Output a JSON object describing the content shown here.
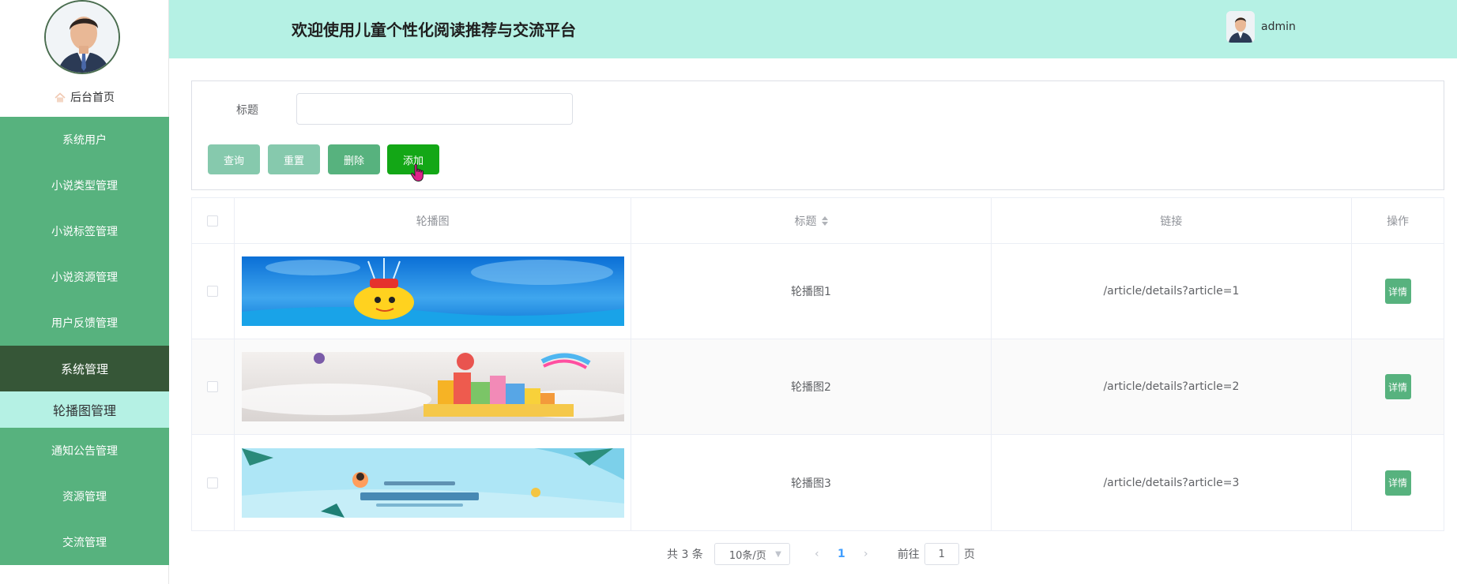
{
  "app": {
    "title": "欢迎使用儿童个性化阅读推荐与交流平台",
    "username": "admin"
  },
  "sidebar": {
    "home_label": "后台首页",
    "items": [
      {
        "label": "系统用户"
      },
      {
        "label": "小说类型管理"
      },
      {
        "label": "小说标签管理"
      },
      {
        "label": "小说资源管理"
      },
      {
        "label": "用户反馈管理"
      },
      {
        "label": "系统管理"
      },
      {
        "label": "轮播图管理"
      },
      {
        "label": "通知公告管理"
      },
      {
        "label": "资源管理"
      },
      {
        "label": "交流管理"
      }
    ]
  },
  "search": {
    "title_label": "标题",
    "title_value": "",
    "buttons": {
      "query": "查询",
      "reset": "重置",
      "delete": "删除",
      "add": "添加"
    }
  },
  "table": {
    "headers": {
      "image": "轮播图",
      "title": "标题",
      "link": "链接",
      "operation": "操作"
    },
    "rows": [
      {
        "title": "轮播图1",
        "link": "/article/details?article=1",
        "action": "详情"
      },
      {
        "title": "轮播图2",
        "link": "/article/details?article=2",
        "action": "详情"
      },
      {
        "title": "轮播图3",
        "link": "/article/details?article=3",
        "action": "详情"
      }
    ]
  },
  "pagination": {
    "total": "共 3 条",
    "page_size": "10条/页",
    "current_page": "1",
    "jump_prefix": "前往",
    "jump_value": "1",
    "jump_suffix": "页"
  },
  "colors": {
    "sidebar_green": "#57b27e",
    "sidebar_active": "#365637",
    "header_bg": "#b5f1e4",
    "add_button": "#13a716",
    "page_active": "#409eff"
  },
  "icons": {
    "home": "home-icon",
    "sort": "sort-caret-icon",
    "prev": "chevron-left-icon",
    "next": "chevron-right-icon",
    "cursor": "hand-pointer-icon"
  }
}
